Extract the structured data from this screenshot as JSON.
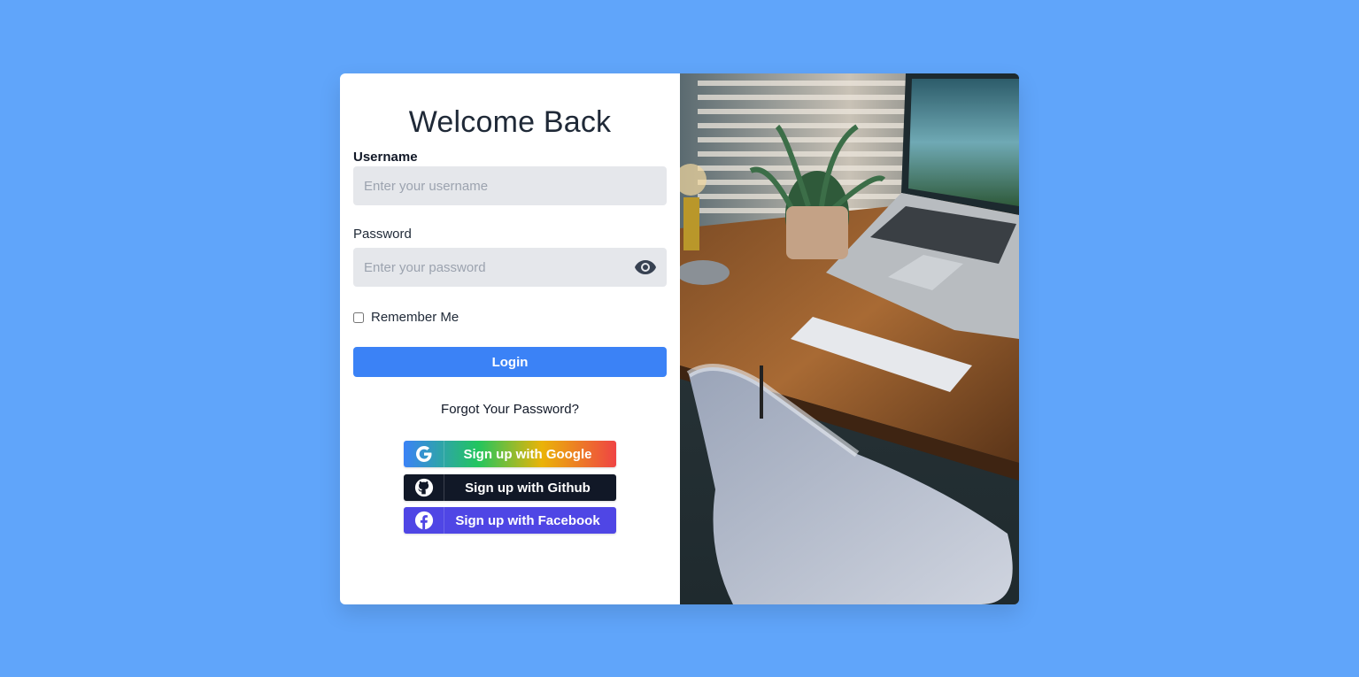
{
  "login": {
    "title": "Welcome Back",
    "username_label": "Username",
    "username_placeholder": "Enter your username",
    "password_label": "Password",
    "password_placeholder": "Enter your password",
    "remember_label": "Remember Me",
    "login_label": "Login",
    "forgot_label": "Forgot Your Password?"
  },
  "social": [
    {
      "label": "Sign up with Google",
      "icon": "google-icon"
    },
    {
      "label": "Sign up with Github",
      "icon": "github-icon"
    },
    {
      "label": "Sign up with Facebook",
      "icon": "facebook-icon"
    }
  ],
  "colors": {
    "background": "#60a5fa",
    "primary": "#3b82f6",
    "github": "#111827",
    "facebook": "#4f46e5"
  }
}
